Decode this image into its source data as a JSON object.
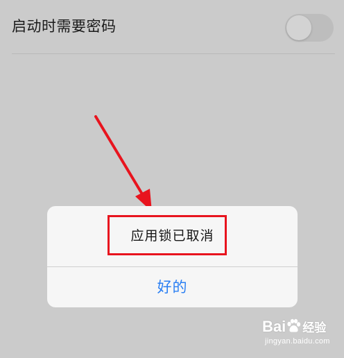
{
  "settings": {
    "require_password_label": "启动时需要密码",
    "require_password_enabled": false
  },
  "dialog": {
    "message": "应用锁已取消",
    "confirm_label": "好的"
  },
  "watermark": {
    "logo_text_prefix": "Bai",
    "logo_text_suffix": "经验",
    "url": "jingyan.baidu.com"
  },
  "colors": {
    "background": "#cbcbcb",
    "dialog_background": "#f6f6f6",
    "accent_blue": "#2a7ff3",
    "annotation_red": "#e8141e",
    "toggle_off": "#bdbdbd"
  },
  "icons": {
    "toggle": "toggle-switch-off",
    "annotation_arrow": "red-arrow-icon",
    "watermark_logo": "baidu-paw-icon"
  }
}
